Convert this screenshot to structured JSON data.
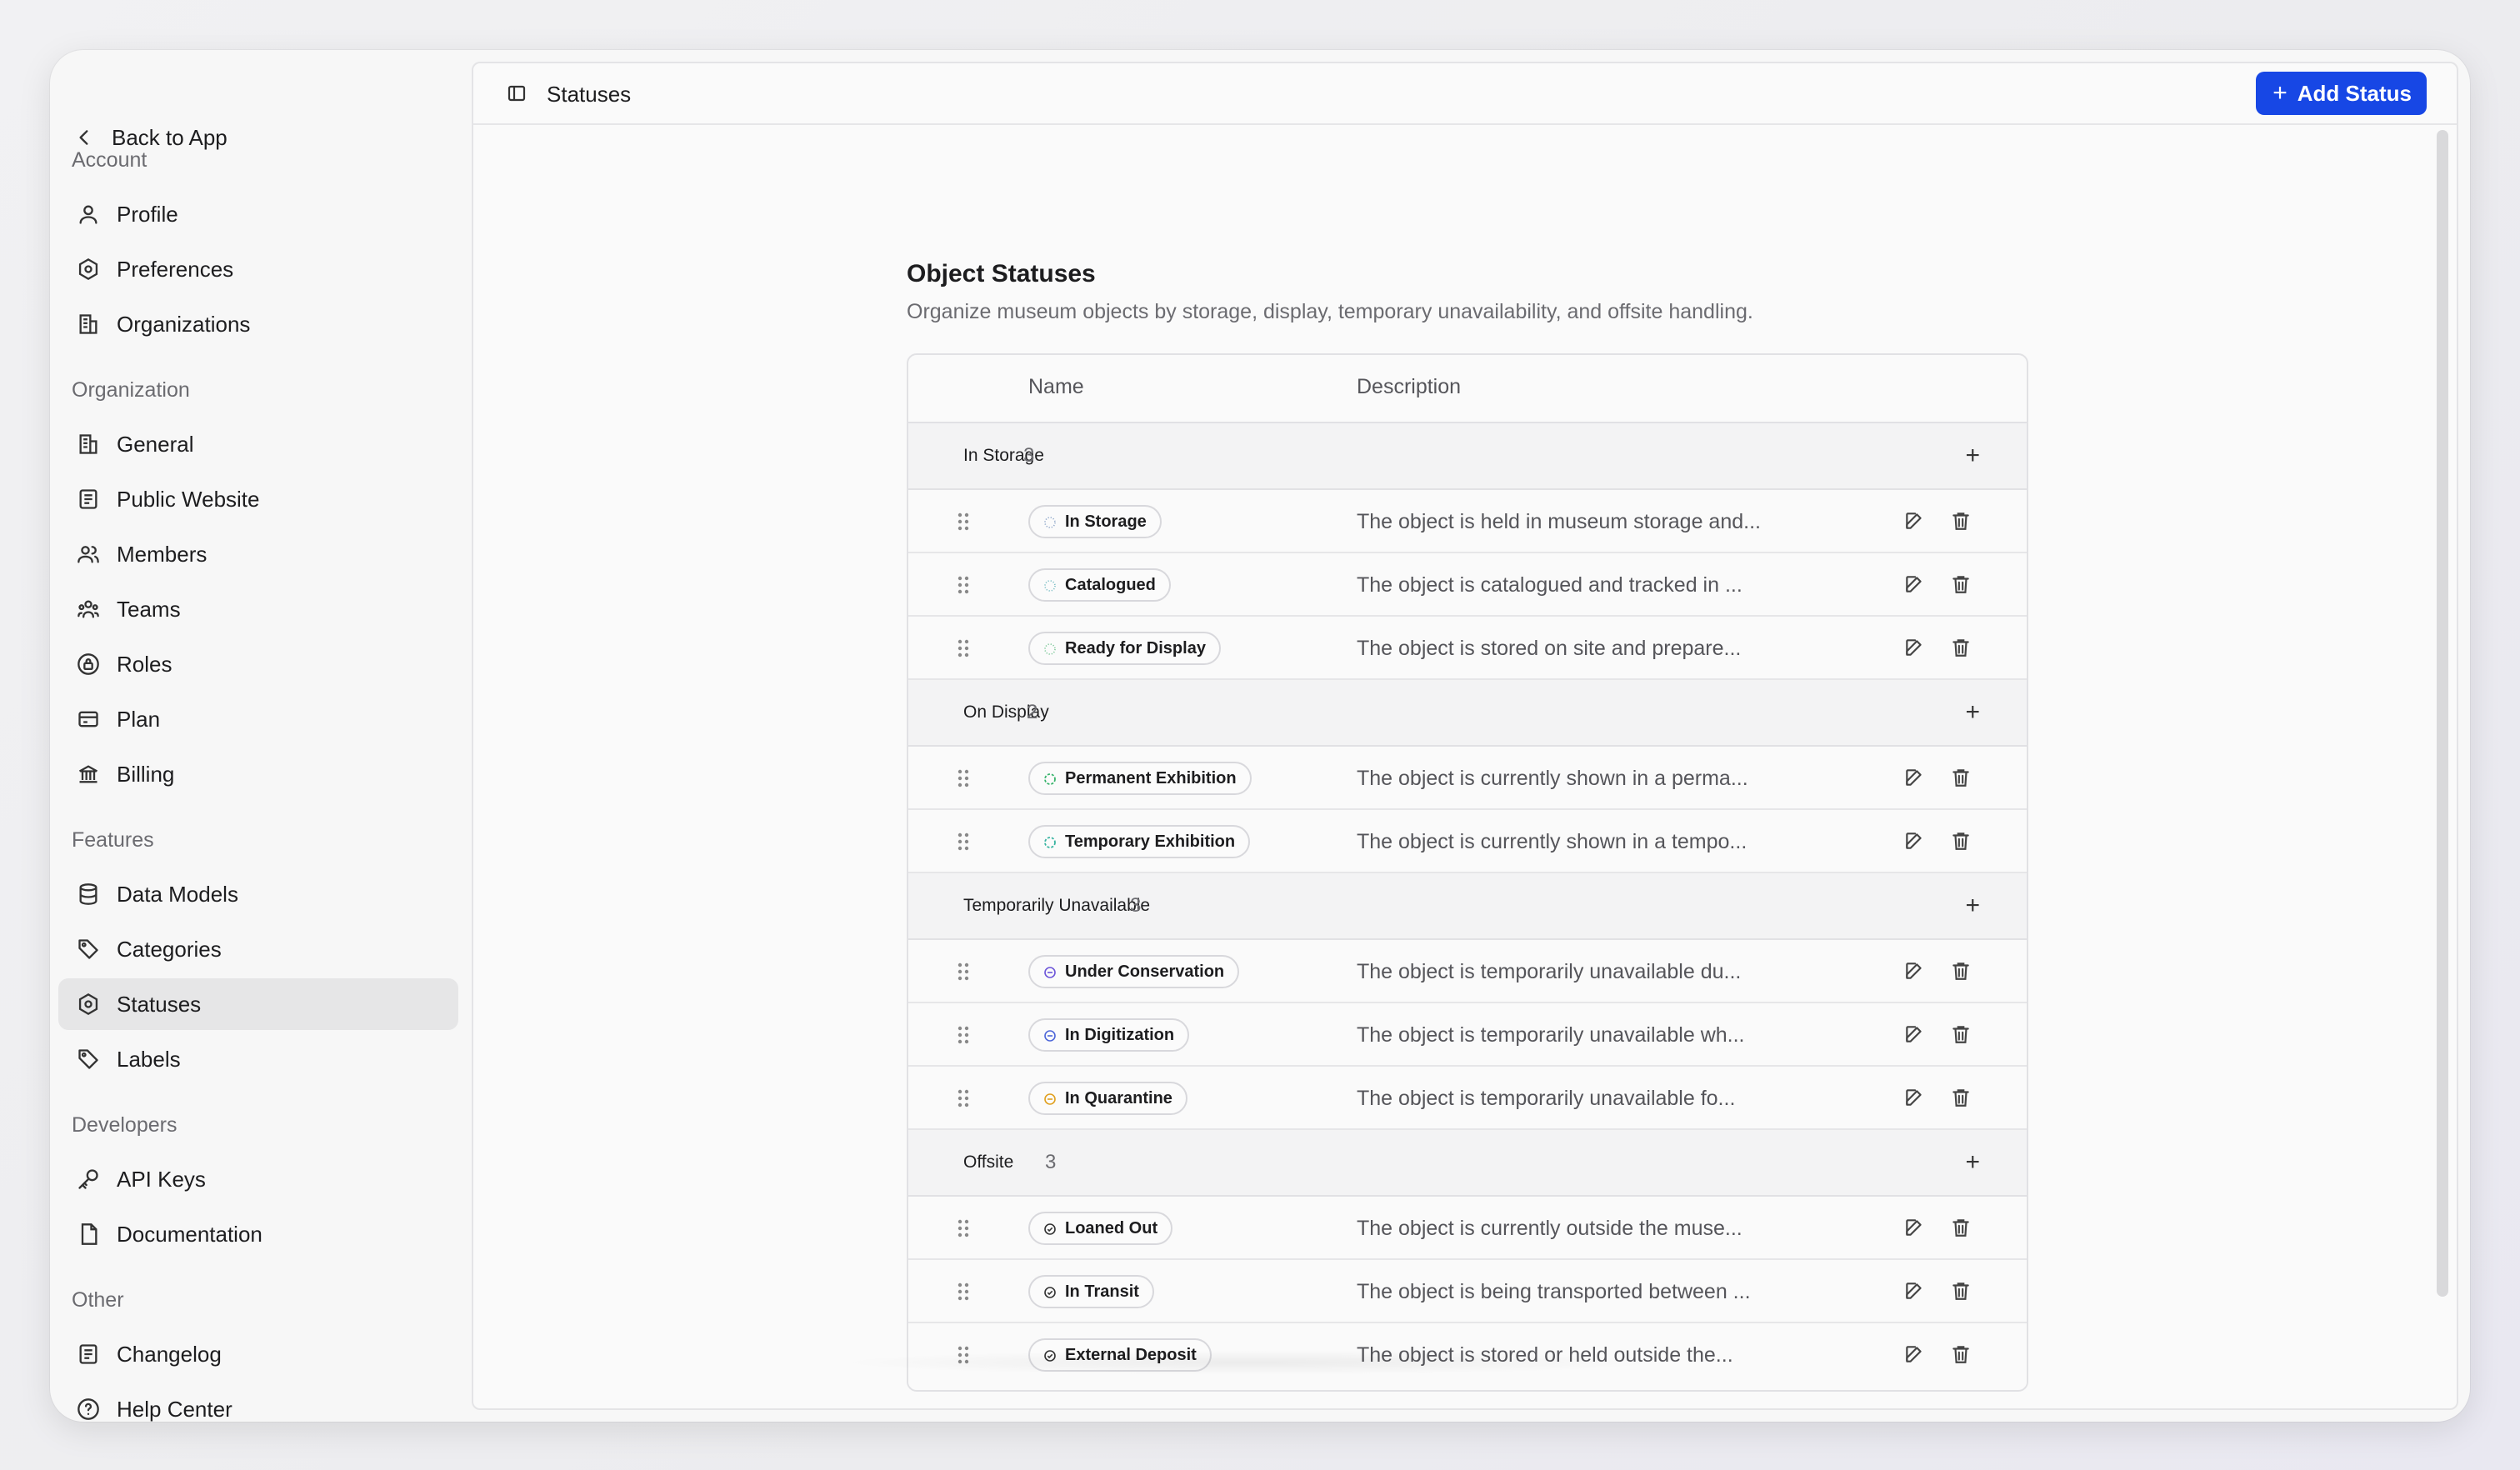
{
  "sidebar": {
    "back_label": "Back to App",
    "sections": {
      "account": "Account",
      "organization": "Organization",
      "features": "Features",
      "developers": "Developers",
      "other": "Other"
    },
    "items": {
      "profile": "Profile",
      "preferences": "Preferences",
      "organizations": "Organizations",
      "general": "General",
      "public_website": "Public Website",
      "members": "Members",
      "teams": "Teams",
      "roles": "Roles",
      "plan": "Plan",
      "billing": "Billing",
      "data_models": "Data Models",
      "categories": "Categories",
      "statuses": "Statuses",
      "labels": "Labels",
      "api_keys": "API Keys",
      "documentation": "Documentation",
      "changelog": "Changelog",
      "help_center": "Help Center"
    },
    "active_item": "statuses"
  },
  "topbar": {
    "title": "Statuses",
    "add_button": "Add Status"
  },
  "page": {
    "title": "Object Statuses",
    "subtitle": "Organize museum objects by storage, display, temporary unavailability, and offsite handling."
  },
  "table": {
    "columns": {
      "name": "Name",
      "description": "Description"
    },
    "groups": [
      {
        "name": "In Storage",
        "count": "3",
        "statuses": [
          {
            "name": "In Storage",
            "description": "The object is held in museum storage and...",
            "icon": "dotted-circle-icon",
            "color": "#8fa7c9"
          },
          {
            "name": "Catalogued",
            "description": "The object is catalogued and tracked in ...",
            "icon": "dotted-circle-icon",
            "color": "#7fc0c7"
          },
          {
            "name": "Ready for Display",
            "description": "The object is stored on site and prepare...",
            "icon": "dotted-circle-icon",
            "color": "#7fc99a"
          }
        ]
      },
      {
        "name": "On Display",
        "count": "2",
        "statuses": [
          {
            "name": "Permanent Exhibition",
            "description": "The object is currently shown in a perma...",
            "icon": "dashed-circle-icon",
            "color": "#37b36b"
          },
          {
            "name": "Temporary Exhibition",
            "description": "The object is currently shown in a tempo...",
            "icon": "dashed-circle-icon",
            "color": "#37b3a0"
          }
        ]
      },
      {
        "name": "Temporarily Unavailable",
        "count": "3",
        "statuses": [
          {
            "name": "Under Conservation",
            "description": "The object is temporarily unavailable du...",
            "icon": "minus-circle-icon",
            "color": "#6c55d9"
          },
          {
            "name": "In Digitization",
            "description": "The object is temporarily unavailable wh...",
            "icon": "minus-circle-icon",
            "color": "#4d66d9"
          },
          {
            "name": "In Quarantine",
            "description": "The object is temporarily unavailable fo...",
            "icon": "minus-circle-icon",
            "color": "#e0a020"
          }
        ]
      },
      {
        "name": "Offsite",
        "count": "3",
        "statuses": [
          {
            "name": "Loaned Out",
            "description": "The object is currently outside the muse...",
            "icon": "check-circle-icon",
            "color": "#333333"
          },
          {
            "name": "In Transit",
            "description": "The object is being transported between ...",
            "icon": "check-circle-icon",
            "color": "#333333"
          },
          {
            "name": "External Deposit",
            "description": "The object is stored or held outside the...",
            "icon": "check-circle-icon",
            "color": "#333333"
          }
        ]
      }
    ]
  }
}
